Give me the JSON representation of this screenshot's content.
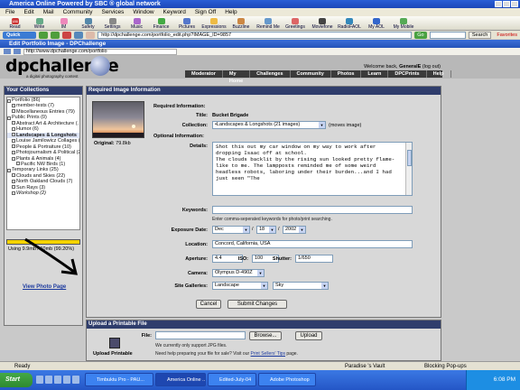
{
  "aol": {
    "title": "America Online Powered by SBC ® global network",
    "menu": [
      "File",
      "Edit",
      "Mail",
      "Community",
      "Services",
      "Window",
      "Keyword",
      "Sign Off",
      "Help"
    ],
    "toolbar": [
      "Read",
      "Write",
      "IM",
      "Safety",
      "Settings",
      "Music",
      "Finance",
      "Pictures",
      "Expressions",
      "Buzzline",
      "Remind Me",
      "Greetings",
      "Moviefone",
      "RadioFAOL",
      "My AOL",
      "My Mobile"
    ],
    "mail_count": "186",
    "quick_start": "Quick Start",
    "url": "http://dpchallenge.com/portfolio_edit.php?IMAGE_ID=9857",
    "go": "Go",
    "search": "Search",
    "favorites": "Favorites"
  },
  "window": {
    "title": "Edit Portfolio Image - DPChallenge",
    "url": "http://www.dpchallenge.com/portfolio"
  },
  "site": {
    "logo": "dpchallenge",
    "tagline": "a digital photography contest",
    "welcome_prefix": "Welcome back, ",
    "username": "GeneralE",
    "logout": "(log out)",
    "nav": [
      "Moderator",
      "My Home",
      "Challenges",
      "Community",
      "Photos",
      "Learn",
      "DPCPrints",
      "Help"
    ]
  },
  "sidebar": {
    "heading": "Your Collections",
    "collections": [
      {
        "label": "Portfolio (86)",
        "box": "-"
      },
      {
        "label": "member-tests (7)",
        "box": ""
      },
      {
        "label": "Miscellaneous Entries (79)",
        "box": ""
      },
      {
        "label": "Public Prints (0)",
        "box": "-"
      },
      {
        "label": "Abstract Art & Architecture (…",
        "box": ""
      },
      {
        "label": "Humor (6)",
        "box": ""
      },
      {
        "label": "Landscapes & Longshots",
        "box": "",
        "selected": true
      },
      {
        "label": "Louise Jamilowicz Collages (",
        "box": ""
      },
      {
        "label": "People & Portraiture (10)",
        "box": ""
      },
      {
        "label": "Photojournalism & Political (2)",
        "box": ""
      },
      {
        "label": "Plants & Animals (4)",
        "box": "-"
      },
      {
        "label": "Pacific NW Birds (1)",
        "box": ""
      },
      {
        "label": "Temporary Links (25)",
        "box": "-"
      },
      {
        "label": "Clouds and Skies (22)",
        "box": ""
      },
      {
        "label": "North Oakland Clouds (7)",
        "box": ""
      },
      {
        "label": "Sun Rays (3)",
        "box": ""
      },
      {
        "label": "Workshop (2)",
        "box": ""
      }
    ],
    "usage_fraction": 0.992,
    "usage": "Using 9.9mb / 10mb (99.20%)",
    "view_photo": "View Photo Page"
  },
  "main": {
    "heading": "Required Image Information",
    "required_label": "Required Information:",
    "title_label": "Title:",
    "title_value": "Bucket Brigade",
    "collection_label": "Collection:",
    "collection_value": "•Landscapes & Longshots (21 images)",
    "moves_image": "(moves image)",
    "optional_label": "Optional Information:",
    "details_label": "Details:",
    "details_text": "Shot this out my car window on my way to work after dropping Isaac off at school.\nThe clouds backlit by the rising sun looked pretty flame-like to me. The lampposts reminded me of some weird headless robots, laboring under their burden...and I had just seen \"The",
    "original": "Original:",
    "original_size": "79.8kb",
    "keywords_label": "Keywords:",
    "keywords_value": "",
    "keywords_hint": "Enter comma-seperated keywords for photo/print searching.",
    "exposure_label": "Exposure Date:",
    "exposure_month": "Dec",
    "exposure_day": "18",
    "exposure_year": "2002",
    "location_label": "Location:",
    "location_value": "Concord, California, USA",
    "aperture_label": "Aperture:",
    "aperture_value": "4.4",
    "iso_label": "ISO:",
    "iso_value": "100",
    "shutter_label": "Shutter:",
    "shutter_value": "1/650",
    "camera_label": "Camera:",
    "camera_value": "Olympus D-490Z",
    "galleries_label": "Site Galleries:",
    "gallery1": "Landscape",
    "gallery2": "Sky",
    "cancel": "Cancel",
    "submit": "Submit Changes"
  },
  "upload": {
    "heading": "Upload a Printable File",
    "file_label": "File:",
    "file_value": "",
    "browse": "Browse...",
    "upload_btn": "Upload",
    "note": "We currently only support JPG files.",
    "help_prefix": "Need help preparing your file for sale? Visit our ",
    "help_link": "Print Sellers' Tips",
    "help_suffix": " page.",
    "icon_label": "Upload Printable"
  },
  "status": {
    "ready": "Ready",
    "paradise": "Paradise 's Vault",
    "blocking": "Blocking Pop-ups"
  },
  "taskbar": {
    "start": "Start",
    "tasks": [
      "Timbuktu Pro - PAU...",
      "America Online ...",
      "Edited-July-04",
      "Adobe Photoshop"
    ],
    "time": "6:08 PM"
  },
  "colors": {
    "nav_bg": "#3a3a3a",
    "panel_head": "#2f3d6c",
    "usage_bar": "#f5d300"
  }
}
